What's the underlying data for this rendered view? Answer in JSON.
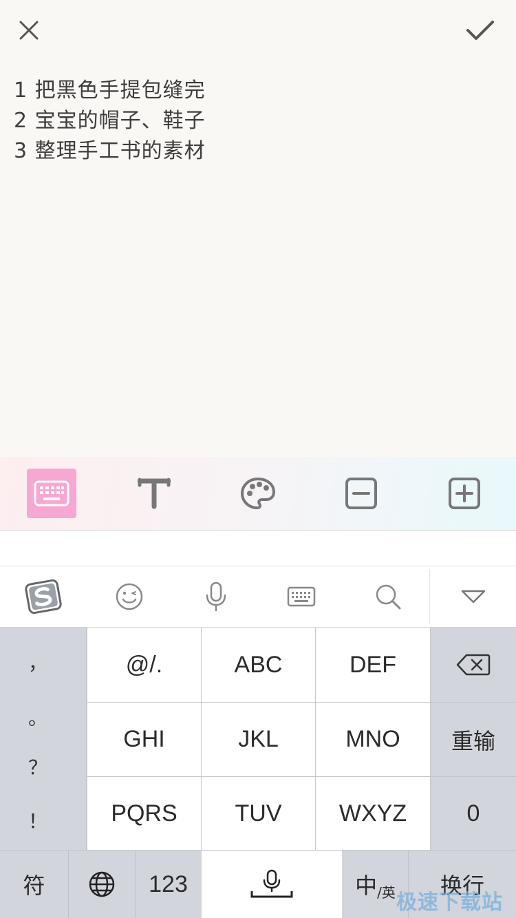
{
  "header": {
    "close_icon": "close-icon",
    "done_icon": "checkmark-icon"
  },
  "note": {
    "lines": [
      "1 把黑色手提包缝完",
      "2 宝宝的帽子、鞋子",
      "3 整理手工书的素材"
    ]
  },
  "format_toolbar": {
    "items": [
      {
        "icon": "keyboard-icon",
        "active": true
      },
      {
        "icon": "text-format-icon",
        "active": false
      },
      {
        "icon": "palette-icon",
        "active": false
      },
      {
        "icon": "minus-square-icon",
        "active": false
      },
      {
        "icon": "plus-square-icon",
        "active": false
      }
    ],
    "active_color": "#f7a8d2"
  },
  "keyboard": {
    "toolbar_icons": [
      "sogou-logo-icon",
      "emoji-icon",
      "microphone-icon",
      "keyboard-icon",
      "search-icon",
      "collapse-keyboard-icon"
    ],
    "symbols": [
      "，",
      "。",
      "？",
      "！"
    ],
    "keys": {
      "r1c1": "@/.",
      "r1c2": "ABC",
      "r1c3": "DEF",
      "r2c1": "GHI",
      "r2c2": "JKL",
      "r2c3": "MNO",
      "r3c1": "PQRS",
      "r3c2": "TUV",
      "r3c3": "WXYZ"
    },
    "right_keys": {
      "backspace_icon": "backspace-icon",
      "retype": "重输",
      "zero": "0"
    },
    "bottom": {
      "symbols": "符",
      "globe_icon": "globe-icon",
      "numbers": "123",
      "space_icon": "voice-space-icon",
      "lang_main": "中",
      "lang_sub": "/英",
      "enter": "换行"
    }
  },
  "watermark": "极速下载站"
}
